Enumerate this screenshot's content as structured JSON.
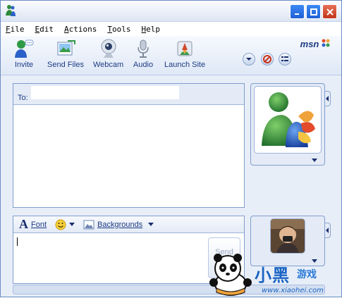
{
  "menu": {
    "items": [
      "File",
      "Edit",
      "Actions",
      "Tools",
      "Help"
    ]
  },
  "toolbar": {
    "buttons": [
      {
        "label": "Invite",
        "icon": "invite-icon"
      },
      {
        "label": "Send Files",
        "icon": "send-files-icon"
      },
      {
        "label": "Webcam",
        "icon": "webcam-icon"
      },
      {
        "label": "Audio",
        "icon": "audio-icon"
      },
      {
        "label": "Launch Site",
        "icon": "launch-site-icon"
      }
    ],
    "logo": "msn"
  },
  "conversation": {
    "to_label": "To:",
    "to_value": ""
  },
  "compose": {
    "font_label": "Font",
    "backgrounds_label": "Backgrounds",
    "send_label": "Send",
    "text": ""
  },
  "watermark": {
    "title": "小黑",
    "subtitle": "游戏",
    "url": "www.xiaohei.com"
  },
  "colors": {
    "accent": "#1c3b82",
    "panel_border": "#7f9dcf",
    "background": "#e8eef8"
  }
}
